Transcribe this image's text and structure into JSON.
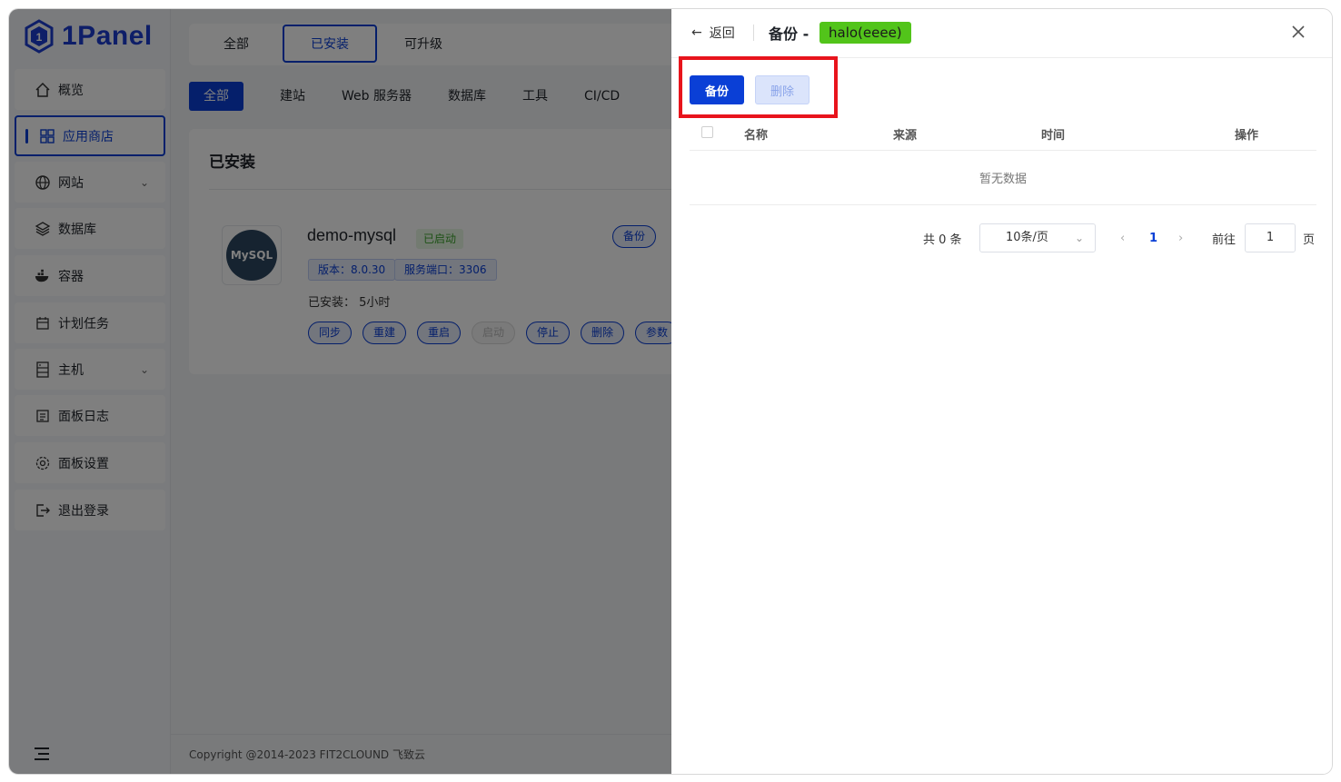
{
  "brand": {
    "name": "1Panel",
    "color": "#1d3dd0"
  },
  "sidebar": {
    "items": [
      {
        "label": "概览",
        "icon": "home-icon"
      },
      {
        "label": "应用商店",
        "icon": "grid-icon",
        "active": true
      },
      {
        "label": "网站",
        "icon": "globe-icon",
        "expandable": true
      },
      {
        "label": "数据库",
        "icon": "layers-icon"
      },
      {
        "label": "容器",
        "icon": "docker-icon"
      },
      {
        "label": "计划任务",
        "icon": "calendar-icon"
      },
      {
        "label": "主机",
        "icon": "server-icon",
        "expandable": true
      },
      {
        "label": "面板日志",
        "icon": "log-icon"
      },
      {
        "label": "面板设置",
        "icon": "gear-icon"
      },
      {
        "label": "退出登录",
        "icon": "logout-icon"
      }
    ]
  },
  "main": {
    "tabs": [
      "全部",
      "已安装",
      "可升级"
    ],
    "active_tab": "已安装",
    "categories": [
      "全部",
      "建站",
      "Web 服务器",
      "数据库",
      "工具",
      "CI/CD"
    ],
    "section_title": "已安装",
    "app": {
      "logo_text": "MySQL",
      "name": "demo-mysql",
      "status": "已启动",
      "version_tag": "版本：8.0.30",
      "port_tag": "服务端口：3306",
      "installed_time": "已安装：  5小时",
      "backup_action": "备份",
      "actions": [
        "同步",
        "重建",
        "重启",
        "启动",
        "停止",
        "删除",
        "参数"
      ],
      "disabled_action": "启动"
    },
    "footer": "Copyright @2014-2023 FIT2CLOUND 飞致云"
  },
  "drawer": {
    "back_label": "返回",
    "title": "备份 -",
    "app_tag": "halo(eeee)",
    "buttons": {
      "backup": "备份",
      "delete": "删除"
    },
    "table": {
      "columns": [
        "名称",
        "来源",
        "时间",
        "操作"
      ],
      "empty_text": "暂无数据"
    },
    "pagination": {
      "total": "共 0 条",
      "page_size": "10条/页",
      "current_page": "1",
      "goto_label": "前往",
      "goto_value": "1",
      "page_suffix": "页"
    }
  },
  "colors": {
    "primary": "#0a3fd6",
    "success": "#52c41a",
    "highlight": "#e8141c"
  }
}
